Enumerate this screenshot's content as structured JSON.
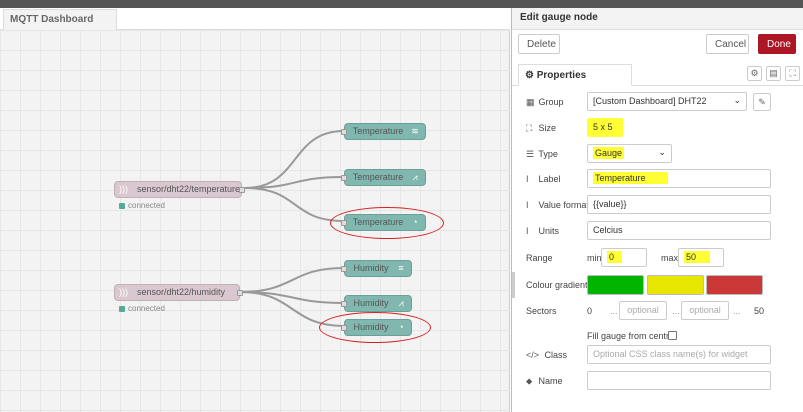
{
  "workspace": {
    "tab_label": "MQTT Dashboard",
    "nodes": [
      {
        "id": "mqtt-temp",
        "label": "sensor/dht22/temperature",
        "status": "connected"
      },
      {
        "id": "temp-chart",
        "label": "Temperature",
        "icon": "chart-icon"
      },
      {
        "id": "temp-text",
        "label": "Temperature",
        "icon": "text-icon"
      },
      {
        "id": "temp-gauge",
        "label": "Temperature",
        "icon": "gauge-icon"
      },
      {
        "id": "mqtt-hum",
        "label": "sensor/dht22/humidity",
        "status": "connected"
      },
      {
        "id": "hum-text",
        "label": "Humidity",
        "icon": "text-icon"
      },
      {
        "id": "hum-chart",
        "label": "Humidity",
        "icon": "chart-icon"
      },
      {
        "id": "hum-gauge",
        "label": "Humidity",
        "icon": "gauge-icon"
      }
    ]
  },
  "editor": {
    "title": "Edit gauge node",
    "delete_label": "Delete",
    "cancel_label": "Cancel",
    "done_label": "Done",
    "properties_tab": "Properties",
    "group": {
      "label": "Group",
      "value": "[Custom Dashboard] DHT22"
    },
    "size": {
      "label": "Size",
      "value": "5 x 5"
    },
    "type": {
      "label": "Type",
      "value": "Gauge"
    },
    "field_label": {
      "label": "Label",
      "value": "Temperature"
    },
    "value_format": {
      "label": "Value format",
      "value": "{{value}}"
    },
    "units": {
      "label": "Units",
      "value": "Celcius"
    },
    "range": {
      "label": "Range",
      "min_label": "min",
      "min_value": "0",
      "max_label": "max",
      "max_value": "50"
    },
    "colour": {
      "label": "Colour gradient",
      "colors": [
        "#00b400",
        "#e6e600",
        "#ca3838"
      ]
    },
    "sectors": {
      "label": "Sectors",
      "start": "0",
      "placeholder": "optional",
      "end": "50",
      "dots": "..."
    },
    "fill_label": "Fill gauge from centre.",
    "class": {
      "label": "Class",
      "placeholder": "Optional CSS class name(s) for widget"
    },
    "name": {
      "label": "Name",
      "value": ""
    }
  },
  "colors": {
    "done": "#ad1625",
    "highlight": "#ffff33",
    "annotation": "#d62020",
    "node_out": "#80b8b0",
    "node_in": "#d9c8cf"
  }
}
